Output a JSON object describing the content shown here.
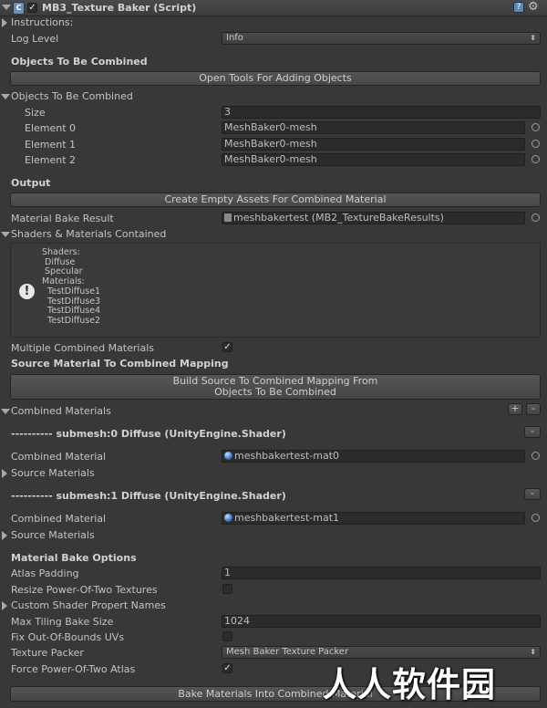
{
  "header": {
    "title": "MB3_Texture Baker (Script)",
    "icon": "script-icon",
    "enabled_check": "✓"
  },
  "instructions": "Instructions:",
  "log_level": {
    "label": "Log Level",
    "value": "Info"
  },
  "objects_section": {
    "title": "Objects To Be Combined",
    "open_tools_button": "Open Tools For Adding Objects",
    "foldout_label": "Objects To Be Combined",
    "size_label": "Size",
    "size_value": "3",
    "elements": [
      {
        "label": "Element 0",
        "value": "MeshBaker0-mesh"
      },
      {
        "label": "Element 1",
        "value": "MeshBaker0-mesh"
      },
      {
        "label": "Element 2",
        "value": "MeshBaker0-mesh"
      }
    ]
  },
  "output": {
    "title": "Output",
    "create_assets_button": "Create Empty Assets For Combined Material",
    "bake_result_label": "Material Bake Result",
    "bake_result_value": "meshbakertest (MB2_TextureBakeResults)",
    "shaders_foldout": "Shaders & Materials Contained",
    "help_text": "Shaders:\n Diffuse\n Specular\nMaterials:\n  TestDiffuse1\n  TestDiffuse3\n  TestDiffuse4\n  TestDiffuse2",
    "multiple_label": "Multiple Combined Materials",
    "multiple_checked": "✓"
  },
  "mapping": {
    "title": "Source Material To Combined Mapping",
    "build_button_line1": "Build Source To Combined Mapping From",
    "build_button_line2": "Objects To Be Combined",
    "combined_foldout": "Combined Materials",
    "plus": "+",
    "minus": "-",
    "submeshes": [
      {
        "title": "---------- submesh:0 Diffuse (UnityEngine.Shader)",
        "combined_label": "Combined Material",
        "combined_value": "meshbakertest-mat0",
        "source_label": "Source Materials",
        "remove": "-"
      },
      {
        "title": "---------- submesh:1 Diffuse (UnityEngine.Shader)",
        "combined_label": "Combined Material",
        "combined_value": "meshbakertest-mat1",
        "source_label": "Source Materials",
        "remove": "-"
      }
    ]
  },
  "bake_options": {
    "title": "Material Bake Options",
    "atlas_padding_label": "Atlas Padding",
    "atlas_padding_value": "1",
    "resize_label": "Resize Power-Of-Two Textures",
    "custom_shader_label": "Custom Shader Propert Names",
    "max_tiling_label": "Max Tiling Bake Size",
    "max_tiling_value": "1024",
    "fix_uvs_label": "Fix Out-Of-Bounds UVs",
    "texture_packer_label": "Texture Packer",
    "texture_packer_value": "Mesh Baker Texture Packer",
    "force_pot_label": "Force Power-Of-Two Atlas",
    "force_pot_checked": "✓",
    "bake_button": "Bake Materials Into Combined Material"
  },
  "watermark": "人人软件园"
}
